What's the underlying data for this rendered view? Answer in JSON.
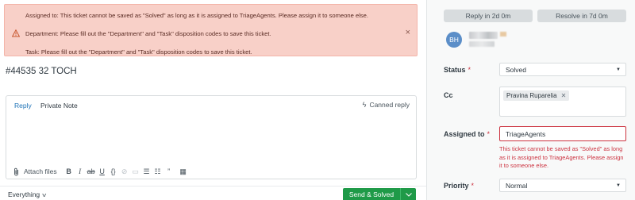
{
  "alert": {
    "line1": "Assigned to: This ticket cannot be saved as \"Solved\" as long as it is assigned to TriageAgents. Please assign it to someone else.",
    "line2": "Department: Please fill out the \"Department\" and \"Task\" disposition codes to save this ticket.",
    "line3": "Task: Please fill out the \"Department\" and \"Task\" disposition codes to save this ticket.",
    "close": "×",
    "icon": "warning-triangle-icon"
  },
  "ticket": {
    "title": "#44535  32 TOCH"
  },
  "composer": {
    "tab_reply": "Reply",
    "tab_note": "Private Note",
    "canned_reply": "Canned reply",
    "attach_label": "Attach files",
    "toolbar": {
      "bold": "B",
      "italic": "I",
      "strike": "ab",
      "underline": "U",
      "code": "{}",
      "link": "⊘",
      "image": "▭",
      "bullets": "☰",
      "numbered": "☷",
      "quote": "”",
      "table": "▦"
    }
  },
  "footer": {
    "view": "Everything",
    "submit": "Send & Solved"
  },
  "sidebar": {
    "sla_reply": "Reply in 2d 0m",
    "sla_resolve": "Resolve in 7d 0m",
    "avatar_initials": "BH",
    "status_label": "Status",
    "status_value": "Solved",
    "cc_label": "Cc",
    "cc_tag": "Pravina Ruparelia",
    "assigned_label": "Assigned to",
    "assigned_value": "TriageAgents",
    "assigned_error": "This ticket cannot be saved as \"Solved\" as long as it is assigned to TriageAgents. Please assign it to someone else.",
    "priority_label": "Priority",
    "priority_value": "Normal",
    "required_mark": "*"
  },
  "colors": {
    "alert_bg": "#f8d0c8",
    "accent": "#1f73b7",
    "submit": "#1f9a48",
    "error": "#cc3340"
  }
}
